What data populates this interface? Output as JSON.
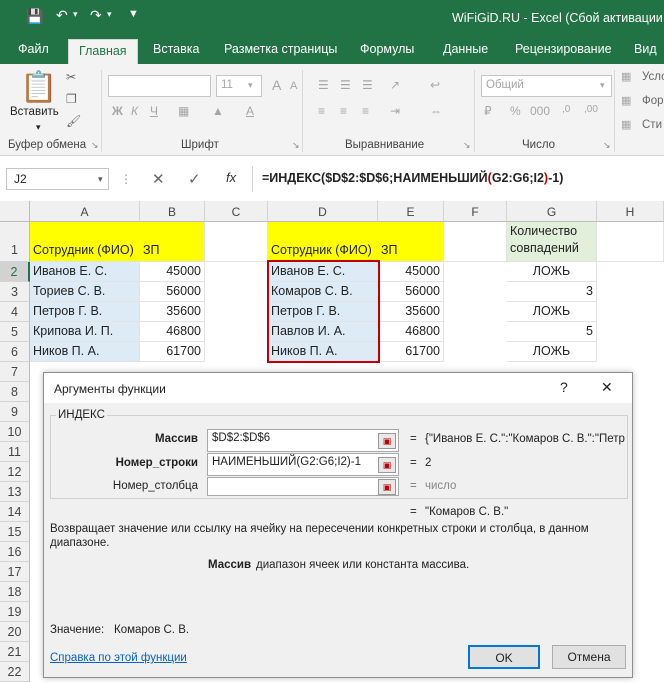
{
  "window": {
    "title": "WiFiGiD.RU - Excel (Сбой активации пр"
  },
  "ribbon": {
    "tabs": [
      "Файл",
      "Главная",
      "Вставка",
      "Разметка страницы",
      "Формулы",
      "Данные",
      "Рецензирование",
      "Вид"
    ],
    "paste_label": "Вставить",
    "groups": {
      "clipboard": "Буфер обмена",
      "font": "Шрифт",
      "alignment": "Выравнивание",
      "number": "Число"
    },
    "font_size": "11",
    "number_format": "Общий",
    "right_items": [
      "Усло",
      "Фор",
      "Сти"
    ]
  },
  "formula_bar": {
    "name_box": "J2",
    "formula_part1": "=ИНДЕКС($D$2:$D$6;НАИМЕНЬШИЙ",
    "formula_paren_open": "(",
    "formula_args": "G2:G6;I2",
    "formula_paren_close": ")",
    "formula_part2": "-1)"
  },
  "sheet": {
    "columns": [
      "A",
      "B",
      "C",
      "D",
      "E",
      "F",
      "G",
      "H"
    ],
    "rows": [
      "1",
      "2",
      "3",
      "4",
      "5",
      "6",
      "7",
      "8",
      "9",
      "10",
      "11",
      "12",
      "13",
      "14",
      "15",
      "16",
      "17",
      "18",
      "19",
      "20",
      "21",
      "22"
    ],
    "headers": {
      "a1": "Сотрудник (ФИО)",
      "b1": "ЗП",
      "d1": "Сотрудник (ФИО)",
      "e1": "ЗП",
      "g1_line1": "Количество",
      "g1_line2": "совпадений"
    },
    "table_a": [
      {
        "name": "Иванов Е. С.",
        "zp": "45000"
      },
      {
        "name": "Ториев С. В.",
        "zp": "56000"
      },
      {
        "name": "Петров Г. В.",
        "zp": "35600"
      },
      {
        "name": "Крипова И. П.",
        "zp": "46800"
      },
      {
        "name": "Ников П. А.",
        "zp": "61700"
      }
    ],
    "table_d": [
      {
        "name": "Иванов Е. С.",
        "zp": "45000"
      },
      {
        "name": "Комаров С. В.",
        "zp": "56000"
      },
      {
        "name": "Петров Г. В.",
        "zp": "35600"
      },
      {
        "name": "Павлов И. А.",
        "zp": "46800"
      },
      {
        "name": "Ников П. А.",
        "zp": "61700"
      }
    ],
    "col_g": [
      "ЛОЖЬ",
      "3",
      "ЛОЖЬ",
      "5",
      "ЛОЖЬ"
    ]
  },
  "dialog": {
    "title": "Аргументы функции",
    "help_glyph": "?",
    "close_glyph": "✕",
    "function_name": "ИНДЕКС",
    "args": [
      {
        "label": "Массив",
        "value": "$D$2:$D$6",
        "result": "{\"Иванов Е. С.\":\"Комаров С. В.\":\"Петр"
      },
      {
        "label": "Номер_строки",
        "value": "НАИМЕНЬШИЙ(G2:G6;I2)-1",
        "result": "2"
      },
      {
        "label": "Номер_столбца",
        "value": "",
        "result": "число"
      }
    ],
    "equals": "=",
    "overall_result": "\"Комаров С. В.\"",
    "description": "Возвращает значение или ссылку на ячейку на пересечении конкретных строки и столбца, в данном диапазоне.",
    "arg_help_name": "Массив",
    "arg_help_text": "диапазон ячеек или константа массива.",
    "value_label": "Значение:",
    "value": "Комаров С. В.",
    "help_link": "Справка по этой функции",
    "ok": "OK",
    "cancel": "Отмена"
  }
}
